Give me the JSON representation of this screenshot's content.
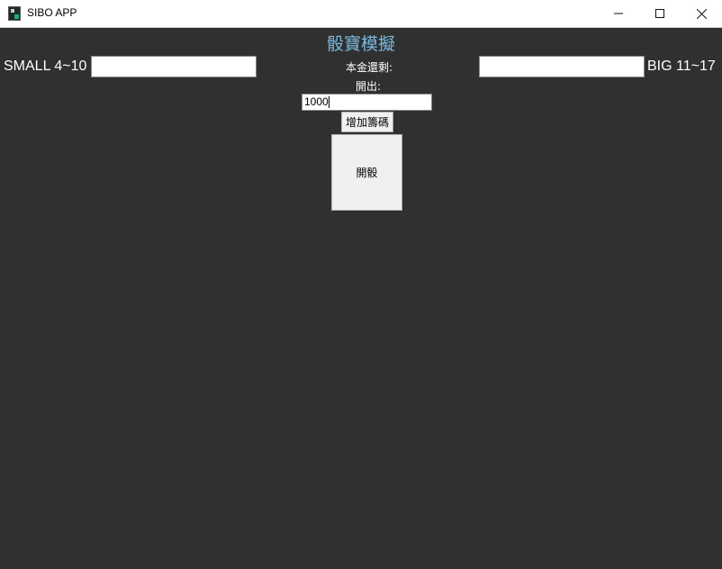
{
  "window": {
    "title": "SIBO APP",
    "icons": {
      "app": "dice-app-icon",
      "minimize": "minimize-icon",
      "maximize": "maximize-icon",
      "close": "close-icon"
    }
  },
  "main": {
    "heading": "骰寶模擬",
    "small_label": "SMALL 4~10",
    "big_label": "BIG 11~17",
    "small_bet_value": "",
    "big_bet_value": "",
    "balance_label": "本金還剩:",
    "result_label": "開出:",
    "amount_value": "1000",
    "add_chips_label": "增加籌碼",
    "roll_label": "開骰"
  },
  "colors": {
    "background": "#303030",
    "heading": "#78b8dc",
    "text": "#ffffff",
    "button": "#f0f0f0"
  }
}
